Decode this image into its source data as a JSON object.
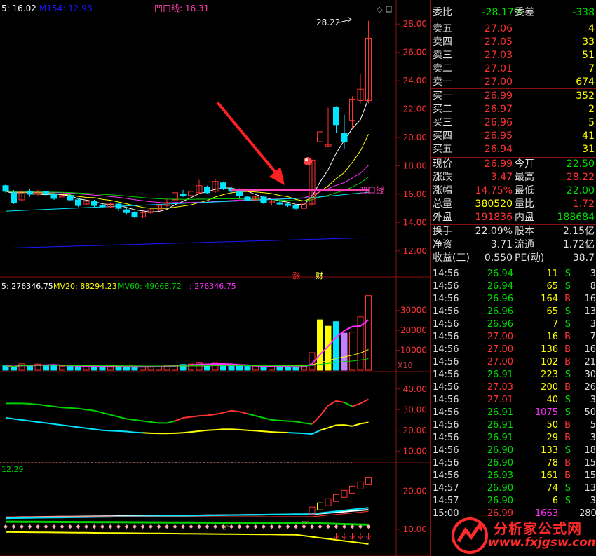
{
  "colors": {
    "up": "#ff3232",
    "down": "#00e5ff",
    "yellow": "#ffff00",
    "magenta": "#ff30ff",
    "white": "#ffffff",
    "green": "#00d200",
    "blue": "#1818ff",
    "pink": "#ff40b0",
    "grid": "#8a1010"
  },
  "header": {
    "main": [
      {
        "text": "5: 16.02",
        "color": "#ffffff"
      },
      {
        "text": "M154: 12.98",
        "color": "#1818ff"
      },
      {
        "text": "凹口线: 16.31",
        "color": "#ff40b0"
      }
    ],
    "vol": [
      {
        "text": "5: 276346.75",
        "color": "#ffffff"
      },
      {
        "text": "MV20: 88294.23",
        "color": "#ffff00"
      },
      {
        "text": "MV60: 49068.72",
        "color": "#00d200"
      },
      {
        "text": ": 276346.75",
        "color": "#ff30ff"
      }
    ],
    "ind2": [
      {
        "text": "12.29",
        "color": "#00d200"
      }
    ]
  },
  "labels": {
    "high_marker": "28.22",
    "dent_line": "凹口线",
    "zhang": "涨",
    "cai": "财",
    "x10": "X10",
    "diamond": "◇"
  },
  "chart_data": [
    {
      "type": "candlestick",
      "panel": "price",
      "title": "",
      "y_ticks": [
        "28.00",
        "26.00",
        "24.00",
        "22.00",
        "20.00",
        "18.00",
        "16.00",
        "14.00",
        "12.00"
      ],
      "ylim": [
        11,
        29
      ],
      "candles": [
        [
          16.6,
          16.2,
          16.7,
          16.1
        ],
        [
          16.1,
          15.4,
          16.3,
          15.3
        ],
        [
          15.6,
          16.2,
          16.3,
          15.5
        ],
        [
          16.2,
          16.0,
          16.4,
          15.8
        ],
        [
          16.0,
          16.2,
          16.3,
          15.9
        ],
        [
          16.2,
          16.0,
          16.3,
          15.9
        ],
        [
          16.0,
          15.7,
          16.1,
          15.6
        ],
        [
          15.8,
          15.9,
          16.0,
          15.7
        ],
        [
          15.9,
          15.6,
          16.0,
          15.5
        ],
        [
          15.6,
          15.2,
          15.7,
          15.1
        ],
        [
          15.3,
          15.5,
          15.6,
          15.2
        ],
        [
          15.5,
          15.2,
          15.6,
          15.1
        ],
        [
          15.2,
          15.1,
          15.3,
          15.0
        ],
        [
          15.1,
          15.3,
          15.4,
          15.0
        ],
        [
          15.3,
          15.0,
          15.4,
          14.8
        ],
        [
          14.9,
          14.7,
          15.0,
          14.6
        ],
        [
          14.7,
          14.4,
          14.8,
          14.3
        ],
        [
          14.4,
          14.7,
          14.8,
          14.3
        ],
        [
          14.7,
          14.9,
          15.0,
          14.6
        ],
        [
          14.9,
          15.2,
          15.3,
          14.8
        ],
        [
          15.2,
          15.4,
          15.7,
          15.1
        ],
        [
          15.6,
          16.1,
          16.2,
          15.4
        ],
        [
          16.0,
          15.9,
          16.3,
          15.8
        ],
        [
          15.9,
          16.2,
          16.3,
          15.8
        ],
        [
          16.1,
          16.6,
          17.0,
          16.0
        ],
        [
          16.5,
          16.1,
          16.6,
          16.0
        ],
        [
          16.2,
          16.9,
          17.1,
          16.1
        ],
        [
          16.8,
          16.4,
          16.9,
          16.3
        ],
        [
          16.4,
          16.2,
          16.5,
          16.0
        ],
        [
          16.2,
          15.9,
          16.4,
          15.7
        ],
        [
          15.8,
          15.6,
          15.9,
          15.5
        ],
        [
          15.6,
          15.8,
          15.9,
          15.5
        ],
        [
          15.8,
          15.4,
          15.9,
          15.3
        ],
        [
          15.4,
          15.5,
          15.6,
          15.2
        ],
        [
          15.4,
          15.3,
          15.6,
          15.2
        ],
        [
          15.3,
          15.2,
          15.4,
          15.1
        ],
        [
          15.2,
          15.0,
          15.3,
          14.9
        ],
        [
          15.0,
          15.3,
          15.5,
          14.9
        ],
        [
          15.3,
          18.4,
          18.4,
          15.2
        ],
        [
          19.7,
          20.4,
          21.2,
          19.4
        ],
        [
          19.4,
          19.5,
          22.1,
          19.3
        ],
        [
          22.1,
          20.9,
          22.2,
          20.3
        ],
        [
          20.3,
          19.7,
          21.6,
          19.2
        ],
        [
          21.2,
          22.7,
          22.9,
          20.7
        ],
        [
          22.6,
          23.4,
          24.5,
          22.4
        ],
        [
          22.6,
          27.0,
          28.22,
          22.4
        ]
      ],
      "ma_lines": [
        {
          "name": "MA5",
          "color": "#ffffff"
        },
        {
          "name": "MA10",
          "color": "#ffff00"
        },
        {
          "name": "MA20",
          "color": "#ff30ff"
        },
        {
          "name": "MA30",
          "color": "#00d200"
        },
        {
          "name": "MA60",
          "color": "#00e5ff"
        },
        {
          "name": "M154",
          "color": "#1818ff"
        }
      ],
      "dent_line_value": 16.31
    },
    {
      "type": "bar",
      "panel": "volume",
      "y_ticks": [
        "30000",
        "20000",
        "10000"
      ],
      "ylim": [
        0,
        38000
      ],
      "values": [
        2200,
        1600,
        3200,
        2400,
        3100,
        2600,
        2200,
        2000,
        1900,
        2100,
        2300,
        2200,
        2000,
        1500,
        1800,
        1500,
        1700,
        1900,
        1800,
        2100,
        2300,
        2600,
        2900,
        3100,
        3600,
        2800,
        3500,
        2900,
        2400,
        2100,
        1900,
        2000,
        1800,
        1600,
        1700,
        1700,
        1600,
        2100,
        8800,
        25300,
        22100,
        24400,
        18600,
        19100,
        26800,
        37400
      ]
    },
    {
      "type": "line",
      "panel": "indicator1",
      "y_ticks": [
        "40.00",
        "30.00",
        "20.00",
        "10.00"
      ],
      "ylim": [
        5,
        45
      ],
      "series": [
        {
          "name": "",
          "color": "#00e5ff",
          "values": [
            26,
            25.5,
            25,
            24.5,
            24,
            23.5,
            23,
            22.5,
            22,
            21.5,
            21,
            20.5,
            20,
            19.8,
            19.6,
            19.4,
            19,
            18.8,
            18.6,
            18.5,
            18.5,
            18.6,
            18.8,
            19.2,
            19.6,
            20,
            20.2,
            20.5,
            20.5,
            20.3,
            20,
            19.8,
            19.5,
            19.2,
            19,
            18.9,
            18.7,
            18.5,
            18.2,
            20,
            21.2,
            22.5,
            22.6,
            22,
            23.2,
            23.8
          ]
        },
        {
          "name": "",
          "color": "#00d200",
          "values": [
            33,
            33,
            33,
            32.8,
            32.5,
            32,
            31.5,
            31,
            30.8,
            30.5,
            30,
            29.5,
            28.5,
            27.5,
            26.5,
            25.5,
            25,
            24.5,
            24,
            23.5,
            23.5,
            24.5,
            26,
            26.5,
            27,
            27.2,
            27.7,
            28.5,
            29.5,
            29,
            28,
            27,
            26,
            25,
            24.7,
            24.5,
            24.2,
            23.5,
            23,
            27,
            32,
            34.2,
            33.5,
            31.5,
            33,
            35
          ]
        },
        {
          "name": "",
          "color": "#ffff00",
          "values": []
        }
      ]
    },
    {
      "type": "line",
      "panel": "indicator2",
      "y_ticks": [
        "20.00",
        "10.00"
      ],
      "ylim": [
        3,
        26
      ]
    }
  ],
  "quote": {
    "weibi": {
      "label": "委比",
      "value": "-28.17%",
      "label2": "委差",
      "value2": "-338"
    },
    "sell": [
      {
        "label": "卖五",
        "price": "27.06",
        "vol": "4"
      },
      {
        "label": "卖四",
        "price": "27.05",
        "vol": "33"
      },
      {
        "label": "卖三",
        "price": "27.03",
        "vol": "51"
      },
      {
        "label": "卖二",
        "price": "27.01",
        "vol": "7"
      },
      {
        "label": "卖一",
        "price": "27.00",
        "vol": "674"
      }
    ],
    "buy": [
      {
        "label": "买一",
        "price": "26.99",
        "vol": "352"
      },
      {
        "label": "买二",
        "price": "26.97",
        "vol": "2"
      },
      {
        "label": "买三",
        "price": "26.96",
        "vol": "5"
      },
      {
        "label": "买四",
        "price": "26.95",
        "vol": "41"
      },
      {
        "label": "买五",
        "price": "26.94",
        "vol": "31"
      }
    ],
    "stats": [
      {
        "l1": "现价",
        "v1": "26.99",
        "c1": "#ff3232",
        "l2": "今开",
        "v2": "22.50",
        "c2": "#00e000"
      },
      {
        "l1": "涨跌",
        "v1": "3.47",
        "c1": "#ff3232",
        "l2": "最高",
        "v2": "28.22",
        "c2": "#ff3232"
      },
      {
        "l1": "涨幅",
        "v1": "14.75%",
        "c1": "#ff3232",
        "l2": "最低",
        "v2": "22.00",
        "c2": "#00e000"
      },
      {
        "l1": "总量",
        "v1": "380520",
        "c1": "#ffff00",
        "l2": "量比",
        "v2": "1.72",
        "c2": "#ff3232"
      },
      {
        "l1": "外盘",
        "v1": "191836",
        "c1": "#ff3232",
        "l2": "内盘",
        "v2": "188684",
        "c2": "#00e000"
      }
    ],
    "stats2": [
      {
        "l1": "换手",
        "v1": "22.09%",
        "l2": "股本",
        "v2": "2.15亿"
      },
      {
        "l1": "净资",
        "v1": "3.71",
        "l2": "流通",
        "v2": "1.72亿"
      },
      {
        "l1": "收益(三)",
        "v1": "0.550",
        "l2": "PE(动)",
        "v2": "38.7"
      }
    ]
  },
  "ticks": [
    {
      "time": "14:56",
      "price": "26.94",
      "vol": "11",
      "bs": "S",
      "n": "3"
    },
    {
      "time": "14:56",
      "price": "26.94",
      "vol": "65",
      "bs": "S",
      "n": "8"
    },
    {
      "time": "14:56",
      "price": "26.96",
      "vol": "164",
      "bs": "B",
      "n": "16"
    },
    {
      "time": "14:56",
      "price": "26.96",
      "vol": "65",
      "bs": "S",
      "n": "13"
    },
    {
      "time": "14:56",
      "price": "26.96",
      "vol": "7",
      "bs": "S",
      "n": "3"
    },
    {
      "time": "14:56",
      "price": "27.00",
      "vol": "16",
      "bs": "B",
      "n": "7"
    },
    {
      "time": "14:56",
      "price": "27.00",
      "vol": "136",
      "bs": "B",
      "n": "16"
    },
    {
      "time": "14:56",
      "price": "27.00",
      "vol": "102",
      "bs": "B",
      "n": "21"
    },
    {
      "time": "14:56",
      "price": "26.91",
      "vol": "223",
      "bs": "S",
      "n": "30"
    },
    {
      "time": "14:56",
      "price": "27.03",
      "vol": "200",
      "bs": "B",
      "n": "26"
    },
    {
      "time": "14:56",
      "price": "27.01",
      "vol": "40",
      "bs": "S",
      "n": "3"
    },
    {
      "time": "14:56",
      "price": "26.91",
      "vol": "1075",
      "bs": "S",
      "n": "50"
    },
    {
      "time": "14:56",
      "price": "26.91",
      "vol": "50",
      "bs": "B",
      "n": "5"
    },
    {
      "time": "14:56",
      "price": "26.91",
      "vol": "29",
      "bs": "B",
      "n": "3"
    },
    {
      "time": "14:56",
      "price": "26.90",
      "vol": "133",
      "bs": "S",
      "n": "18"
    },
    {
      "time": "14:56",
      "price": "26.90",
      "vol": "78",
      "bs": "B",
      "n": "15"
    },
    {
      "time": "14:56",
      "price": "26.93",
      "vol": "161",
      "bs": "B",
      "n": "15"
    },
    {
      "time": "14:57",
      "price": "26.90",
      "vol": "74",
      "bs": "S",
      "n": "13"
    },
    {
      "time": "14:57",
      "price": "26.90",
      "vol": "6",
      "bs": "S",
      "n": "3"
    },
    {
      "time": "15:00",
      "price": "26.99",
      "vol": "1663",
      "bs": "",
      "n": "280"
    }
  ],
  "watermark": {
    "cn": "分析家公式网",
    "url": "www.fxjgsw.com"
  }
}
